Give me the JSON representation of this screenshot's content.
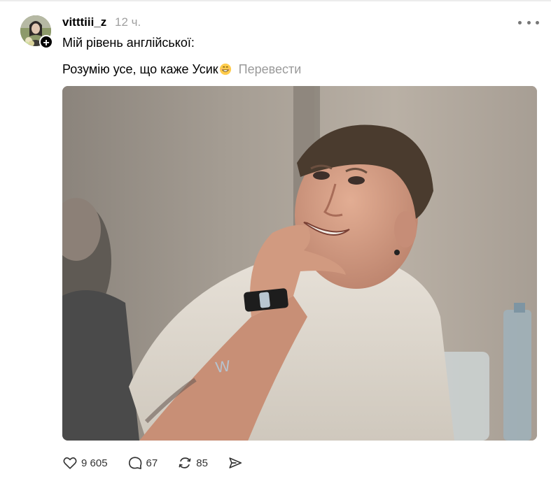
{
  "post": {
    "username": "vitttiii_z",
    "timestamp": "12 ч.",
    "text_line1": "Мій рівень англійської:",
    "text_line2": "Розумію усе, що каже Усик",
    "emoji_icon": "grinning-face-emoji",
    "translate_label": "Перевести"
  },
  "actions": {
    "likes": "9 605",
    "replies": "67",
    "reposts": "85"
  },
  "icons": {
    "more": "more-horizontal-icon",
    "like": "heart-icon",
    "reply": "speech-bubble-icon",
    "repost": "repost-icon",
    "share": "send-icon",
    "follow": "plus-icon"
  },
  "colors": {
    "timestamp": "#a0a0a0",
    "translate": "#9a9a9a",
    "icon_stroke": "#333333"
  }
}
